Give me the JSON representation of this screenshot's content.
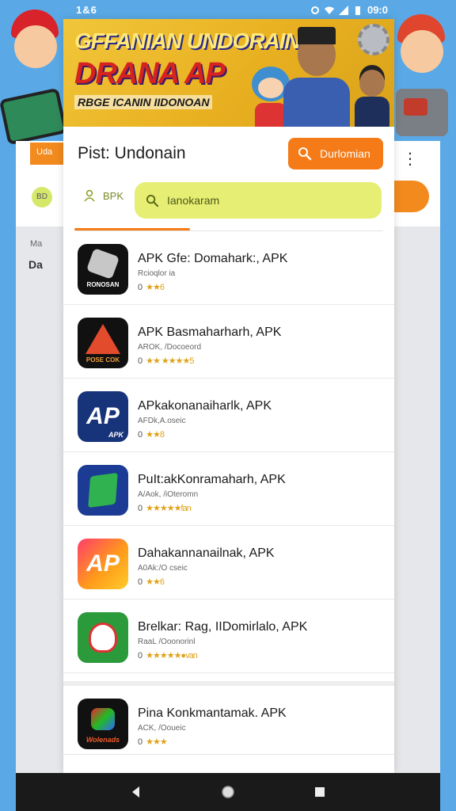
{
  "status_bar": {
    "time": "1&6",
    "battery": "09:0"
  },
  "banner": {
    "line1": "GFFANIAN UNDORAIN",
    "line2": "DRANA AP",
    "line3": "RBGE ICANIN IIDONOAN"
  },
  "header": {
    "title": "Pist: Undonain",
    "download_label": "Durlomian"
  },
  "search": {
    "tab_label": "BPK",
    "placeholder": "Ianokaram"
  },
  "background_page": {
    "tab_label": "Uda",
    "badge": "BD",
    "section_label": "Ma",
    "row_label": "Da"
  },
  "apps": [
    {
      "name": "APK Gfe: Domahark:, APK",
      "sub": "Rcioqlor ia",
      "rating_prefix": "0",
      "stars": "★★6",
      "icon_label": "RONOSAN"
    },
    {
      "name": "APK Basmaharharh, APK",
      "sub": "AROK, /Docoeord",
      "rating_prefix": "0",
      "stars": "★★ ★★★★5",
      "icon_label": "POSE COK"
    },
    {
      "name": "APkakonanaiharlk, APK",
      "sub": "AFDk,A.oseic",
      "rating_prefix": "0",
      "stars": "★★8",
      "icon_label": "APK",
      "icon_text": "AP"
    },
    {
      "name": "PuIt:akKonramaharh, APK",
      "sub": "A/Aok, /iOteromn",
      "rating_prefix": "0",
      "stars": "★★★★★fan",
      "icon_label": ""
    },
    {
      "name": "Dahakannanailnak, APK",
      "sub": "A0Ak:/O cseic",
      "rating_prefix": "0",
      "stars": "★★6",
      "icon_label": "",
      "icon_text": "AP"
    },
    {
      "name": "Brelkar: Rag, IIDomirlalo, APK",
      "sub": "RaaL /Ooonorinl",
      "rating_prefix": "0",
      "stars": "★★★★★●van",
      "icon_label": ""
    },
    {
      "name": "Pina Konkmantamak. APK",
      "sub": "ACK, /Ooueic",
      "rating_prefix": "0",
      "stars": "★★★",
      "icon_label": "Wolenads"
    }
  ]
}
